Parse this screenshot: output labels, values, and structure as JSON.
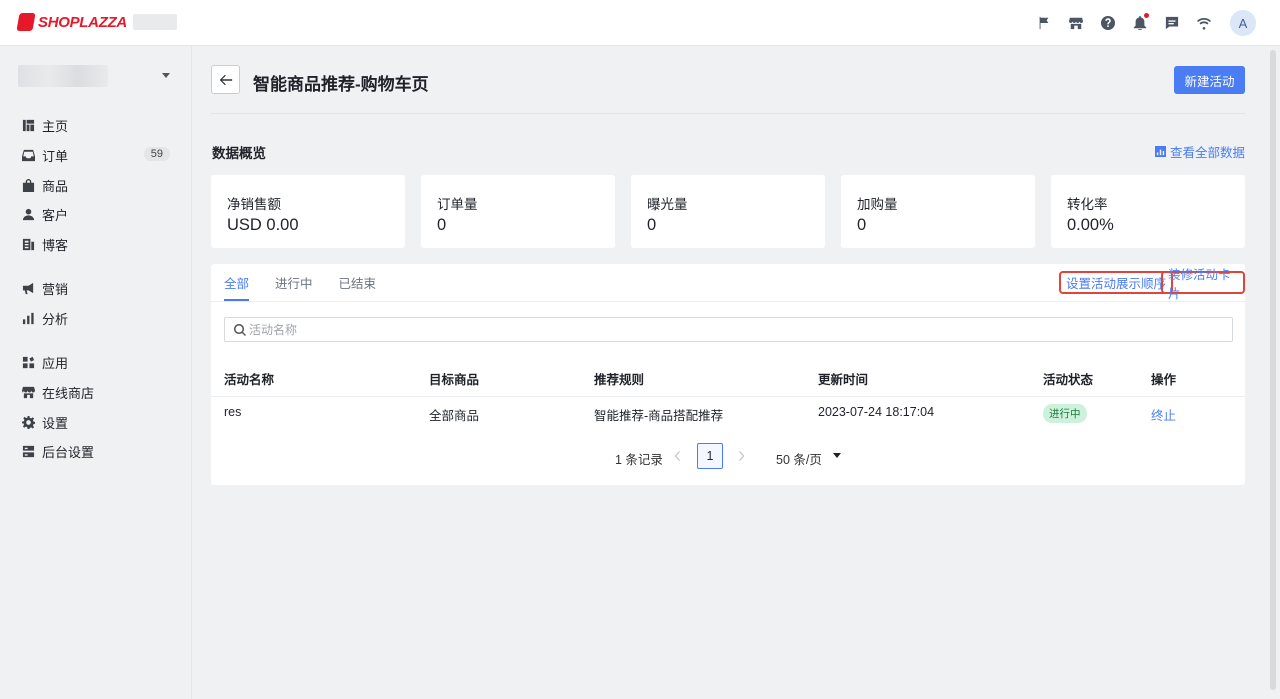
{
  "brand": {
    "logo_text": "SHOPLAZZA",
    "accent": "#4a7cf3",
    "brand_red": "#e5192a"
  },
  "topbar": {
    "icons": [
      "flag-icon",
      "store-icon",
      "help-icon",
      "bell-icon",
      "message-icon",
      "wifi-icon"
    ],
    "avatar_letter": "A"
  },
  "sidebar": {
    "items": [
      {
        "label": "主页",
        "icon": "home-icon"
      },
      {
        "label": "订单",
        "icon": "inbox-icon",
        "badge": "59"
      },
      {
        "label": "商品",
        "icon": "bag-icon"
      },
      {
        "label": "客户",
        "icon": "user-icon"
      },
      {
        "label": "博客",
        "icon": "blog-icon"
      },
      {
        "label": "营销",
        "icon": "megaphone-icon"
      },
      {
        "label": "分析",
        "icon": "bar-chart-icon"
      },
      {
        "label": "应用",
        "icon": "apps-icon"
      },
      {
        "label": "在线商店",
        "icon": "store-icon"
      },
      {
        "label": "设置",
        "icon": "gear-icon"
      },
      {
        "label": "后台设置",
        "icon": "server-icon"
      }
    ]
  },
  "header": {
    "title": "智能商品推荐-购物车页",
    "new_button": "新建活动"
  },
  "overview": {
    "title": "数据概览",
    "view_all": "查看全部数据",
    "stats": [
      {
        "label": "净销售额",
        "value": "USD 0.00"
      },
      {
        "label": "订单量",
        "value": "0"
      },
      {
        "label": "曝光量",
        "value": "0"
      },
      {
        "label": "加购量",
        "value": "0"
      },
      {
        "label": "转化率",
        "value": "0.00%"
      }
    ]
  },
  "panel": {
    "tabs": [
      "全部",
      "进行中",
      "已结束"
    ],
    "set_order_link": "设置活动展示顺序",
    "decorate_link": "装修活动卡片",
    "search_placeholder": "活动名称",
    "columns": [
      "活动名称",
      "目标商品",
      "推荐规则",
      "更新时间",
      "活动状态",
      "操作"
    ],
    "rows": [
      {
        "name": "res",
        "target": "全部商品",
        "rule": "智能推荐-商品搭配推荐",
        "updated": "2023-07-24 18:17:04",
        "status": "进行中",
        "action": "终止"
      }
    ],
    "pagination": {
      "total": "1 条记录",
      "current": "1",
      "page_size": "50 条/页"
    }
  }
}
